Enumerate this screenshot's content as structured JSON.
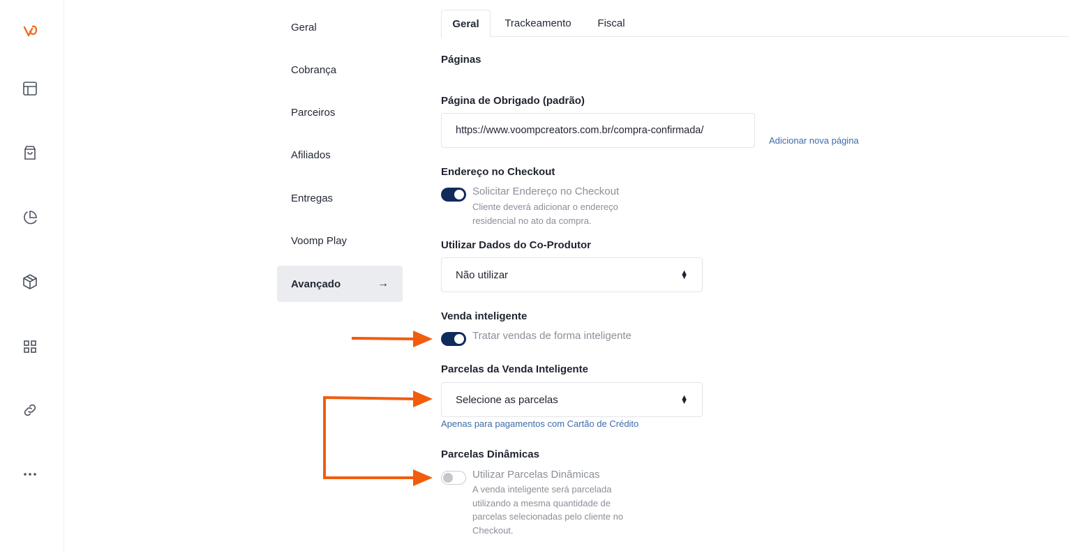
{
  "rail": {
    "icons": [
      "logo-icon",
      "layout-icon",
      "shopping-bag-icon",
      "pie-chart-icon",
      "box-icon",
      "grid-icon",
      "link-icon",
      "more-icon"
    ],
    "brand_color": "#f26b1d"
  },
  "menu": {
    "items": [
      {
        "label": "Geral"
      },
      {
        "label": "Cobrança"
      },
      {
        "label": "Parceiros"
      },
      {
        "label": "Afiliados"
      },
      {
        "label": "Entregas"
      },
      {
        "label": "Voomp Play"
      },
      {
        "label": "Avançado",
        "active": true,
        "arrow": "→"
      }
    ]
  },
  "tabs": [
    {
      "label": "Geral",
      "active": true
    },
    {
      "label": "Trackeamento"
    },
    {
      "label": "Fiscal"
    }
  ],
  "pages": {
    "section_title": "Páginas",
    "thank_you_label": "Página de Obrigado (padrão)",
    "thank_you_value": "https://www.voompcreators.com.br/compra-confirmada/",
    "add_page_link": "Adicionar nova página"
  },
  "address": {
    "label": "Endereço no Checkout",
    "toggle_title": "Solicitar Endereço no Checkout",
    "toggle_desc_line1": "Cliente deverá adicionar o endereço",
    "toggle_desc_line2": "residencial no ato da compra.",
    "enabled": true
  },
  "coproducer": {
    "label": "Utilizar Dados do Co-Produtor",
    "value": "Não utilizar"
  },
  "smart_sale": {
    "label": "Venda inteligente",
    "toggle_title": "Tratar vendas de forma inteligente",
    "enabled": true
  },
  "installments": {
    "label": "Parcelas da Venda Inteligente",
    "placeholder": "Selecione as parcelas",
    "hint": "Apenas para pagamentos com Cartão de Crédito"
  },
  "dynamic": {
    "label": "Parcelas Dinâmicas",
    "toggle_title": "Utilizar Parcelas Dinâmicas",
    "desc_line1": "A venda inteligente será parcelada",
    "desc_line2": "utilizando a mesma quantidade de",
    "desc_line3": "parcelas selecionadas pelo cliente no",
    "desc_line4": "Checkout.",
    "enabled": false
  },
  "colors": {
    "toggle_on": "#0f2b5c",
    "annotation_arrow": "#f25c0d",
    "link": "#3d6ba8"
  }
}
